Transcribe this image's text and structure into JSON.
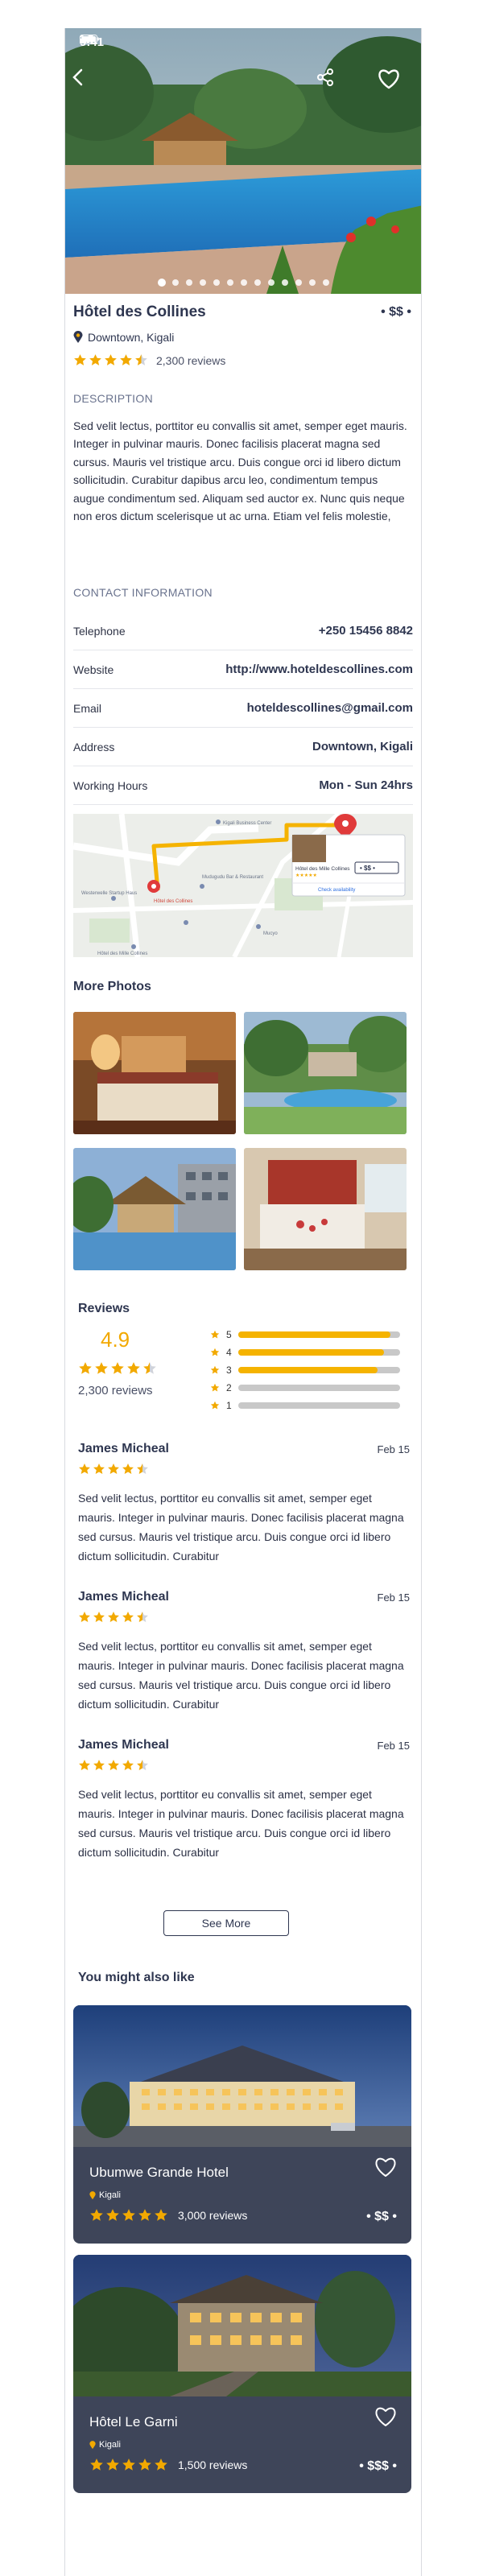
{
  "status_bar": {
    "time": "9:41"
  },
  "hotel": {
    "name": "Hôtel des Collines",
    "price_level": "• $$ •",
    "location": "Downtown, Kigali",
    "rating": 4.5,
    "reviews_count_label": "2,300 reviews"
  },
  "carousel": {
    "total": 13,
    "active": 0
  },
  "description": {
    "label": "DESCRIPTION",
    "text": "Sed velit lectus, porttitor eu convallis sit amet, semper eget mauris. Integer in pulvinar mauris. Donec facilisis placerat magna sed cursus. Mauris vel tristique arcu. Duis congue orci id libero dictum sollicitudin. Curabitur dapibus arcu leo, condimentum tempus augue condimentum sed. Aliquam sed auctor ex. Nunc quis neque non eros dictum scelerisque ut ac urna. Etiam vel felis molestie,"
  },
  "contact": {
    "label": "CONTACT INFORMATION",
    "rows": [
      {
        "key": "Telephone",
        "value": "+250 15456 8842"
      },
      {
        "key": "Website",
        "value": "http://www.hoteldescollines.com"
      },
      {
        "key": "Email",
        "value": "hoteldescollines@gmail.com"
      },
      {
        "key": "Address",
        "value": "Downtown, Kigali"
      },
      {
        "key": "Working Hours",
        "value": "Mon - Sun  24hrs"
      }
    ]
  },
  "map": {
    "labels": [
      "Kigali Business Center",
      "Westerwelle Startup Haus",
      "Mudugudu Bar & Restaurant",
      "Hôtel des Mille Collines",
      "Mucyo",
      "Hôtel des Collines"
    ],
    "popup_title": "Hôtel des Mille Collines",
    "popup_price": "• $$ •",
    "popup_cta": "Check availability"
  },
  "more_photos": {
    "title": "More Photos"
  },
  "reviews": {
    "title": "Reviews",
    "score": "4.9",
    "score_stars": 4.5,
    "count_label": "2,300 reviews",
    "distribution": [
      {
        "stars": "5",
        "fraction": 0.94
      },
      {
        "stars": "4",
        "fraction": 0.9
      },
      {
        "stars": "3",
        "fraction": 0.86
      },
      {
        "stars": "2",
        "fraction": 0.0
      },
      {
        "stars": "1",
        "fraction": 0.0
      }
    ],
    "items": [
      {
        "author": "James Micheal",
        "date": "Feb 15",
        "stars": 4.5,
        "text": "Sed velit lectus, porttitor eu convallis sit amet, semper eget mauris. Integer in pulvinar mauris. Donec facilisis placerat magna sed cursus. Mauris vel tristique arcu. Duis congue orci id libero dictum sollicitudin. Curabitur"
      },
      {
        "author": "James Micheal",
        "date": "Feb 15",
        "stars": 4.5,
        "text": "Sed velit lectus, porttitor eu convallis sit amet, semper eget mauris. Integer in pulvinar mauris. Donec facilisis placerat magna sed cursus. Mauris vel tristique arcu. Duis congue orci id libero dictum sollicitudin. Curabitur"
      },
      {
        "author": "James Micheal",
        "date": "Feb 15",
        "stars": 4.5,
        "text": "Sed velit lectus, porttitor eu convallis sit amet, semper eget mauris. Integer in pulvinar mauris. Donec facilisis placerat magna sed cursus. Mauris vel tristique arcu. Duis congue orci id libero dictum sollicitudin. Curabitur"
      }
    ],
    "see_more_label": "See More"
  },
  "also_like": {
    "title": "You might also like",
    "cards": [
      {
        "name": "Ubumwe Grande Hotel",
        "location": "Kigali",
        "stars": 5,
        "reviews_label": "3,000 reviews",
        "price_level": "• $$ •"
      },
      {
        "name": "Hôtel Le Garni",
        "location": "Kigali",
        "stars": 5,
        "reviews_label": "1,500 reviews",
        "price_level": "• $$$ •"
      }
    ]
  },
  "colors": {
    "star": "#f2a900",
    "text_dark": "#2e3650",
    "card_bg": "#3e4559"
  }
}
